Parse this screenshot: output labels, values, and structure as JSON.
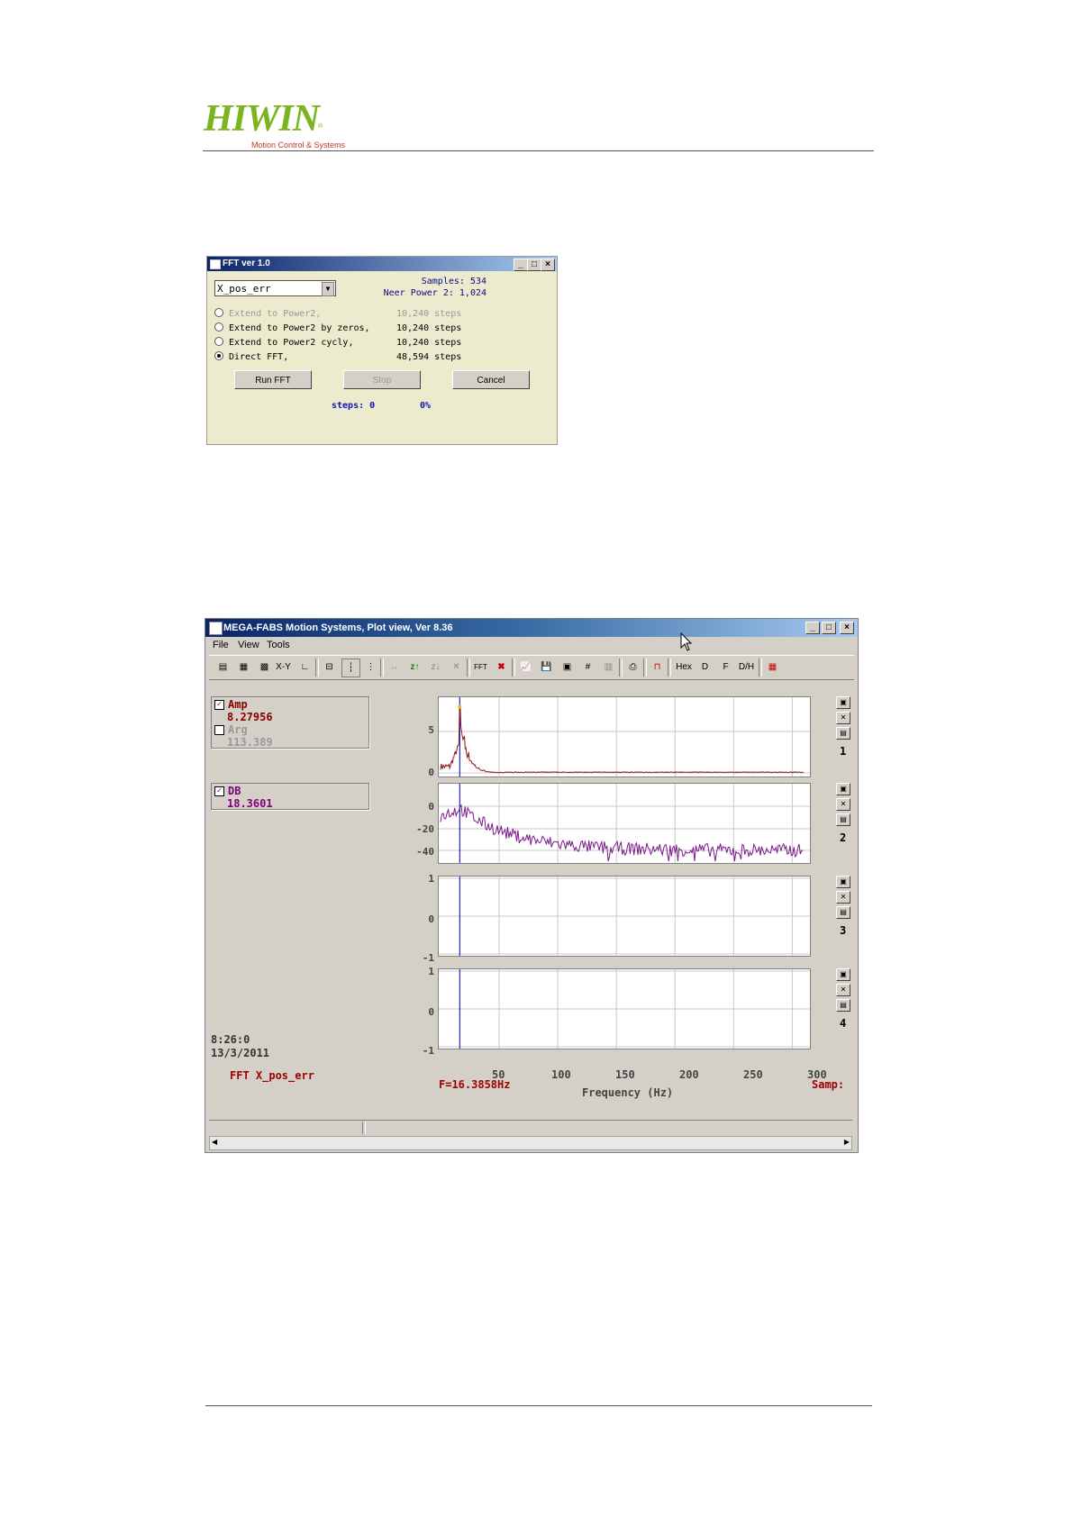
{
  "header": {
    "logo": "HIWIN",
    "logo_reg": "®",
    "tagline": "Motion Control & Systems"
  },
  "fft_dialog": {
    "title": "FFT ver 1.0",
    "signal": "X_pos_err",
    "samples": "Samples: 534",
    "near_power": "Neer Power 2: 1,024",
    "options": [
      {
        "label": "Extend to Power2,",
        "steps": "10,240 steps",
        "selected": false,
        "disabled": true
      },
      {
        "label": "Extend to Power2 by zeros,",
        "steps": "10,240 steps",
        "selected": false,
        "disabled": false
      },
      {
        "label": "Extend to Power2 cycly,",
        "steps": "10,240 steps",
        "selected": false,
        "disabled": false
      },
      {
        "label": "Direct FFT,",
        "steps": "48,594 steps",
        "selected": true,
        "disabled": false
      }
    ],
    "buttons": {
      "run": "Run FFT",
      "stop": "Stop",
      "cancel": "Cancel"
    },
    "status_steps": "steps: 0",
    "status_pct": "0%"
  },
  "plot_window": {
    "title": "MEGA-FABS Motion Systems, Plot view, Ver 8.36",
    "menu": [
      "File",
      "View",
      "Tools"
    ],
    "toolbar": {
      "xy": "X-Y",
      "fft": "FFT",
      "hex": "Hex",
      "d": "D",
      "f": "F",
      "dh": "D/H"
    },
    "channels": [
      {
        "name": "Amp",
        "value": "8.27956",
        "checked": true,
        "color": "#8b0000"
      },
      {
        "name": "Arg",
        "value": "113.389",
        "checked": false,
        "color": "#999999"
      },
      {
        "name": "DB",
        "value": "18.3601",
        "checked": true,
        "color": "#800080"
      }
    ],
    "time": "8:26:0",
    "date": "13/3/2011",
    "footer_left": "FFT X_pos_err",
    "footer_mid": "F=16.3858Hz",
    "footer_right": "Samp:",
    "panel_numbers": [
      "1",
      "2",
      "3",
      "4"
    ]
  },
  "chart_data": [
    {
      "type": "line",
      "series": [
        {
          "name": "Amp",
          "values_peak": 8.28
        }
      ],
      "yticks": [
        "5",
        "0"
      ],
      "xticks": [
        "50",
        "100",
        "150",
        "200",
        "250",
        "300"
      ],
      "xlabel": "Frequency (Hz)",
      "cursor": 16.3858
    },
    {
      "type": "line",
      "series": [
        {
          "name": "DB"
        }
      ],
      "yticks": [
        "0",
        "-20",
        "-40"
      ]
    },
    {
      "type": "line",
      "yticks": [
        "1",
        "0",
        "-1"
      ]
    },
    {
      "type": "line",
      "yticks": [
        "1",
        "0",
        "-1"
      ]
    }
  ]
}
